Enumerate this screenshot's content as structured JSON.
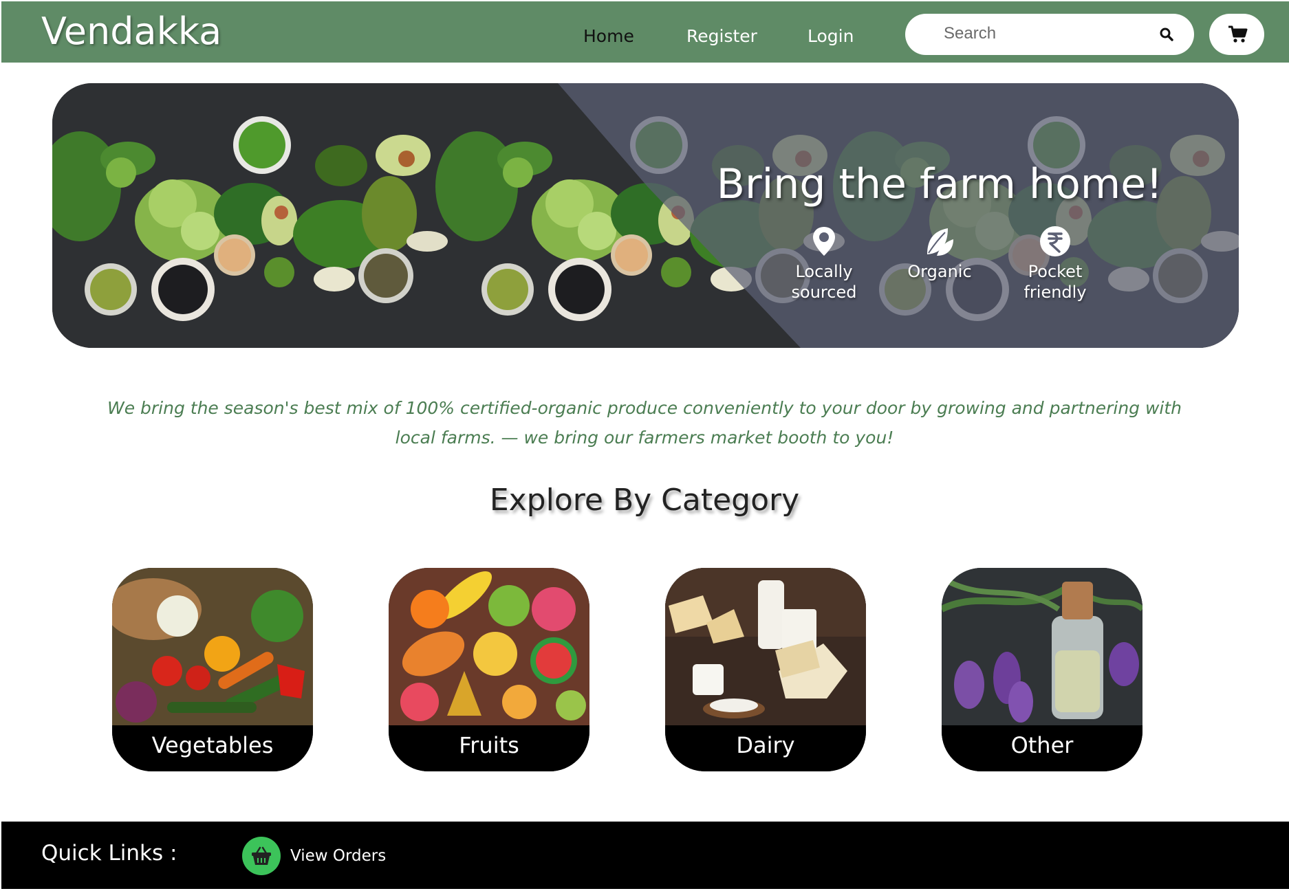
{
  "header": {
    "brand": "Vendakka",
    "nav": {
      "home": "Home",
      "register": "Register",
      "login": "Login"
    },
    "search": {
      "placeholder": "Search"
    },
    "cart_icon": "shopping-cart-icon",
    "search_icon": "magnifier-icon",
    "background_color": "#5f8b66"
  },
  "hero": {
    "title": "Bring the farm home!",
    "features": [
      {
        "icon": "map-pin-icon",
        "line1": "Locally",
        "line2": "sourced"
      },
      {
        "icon": "leaf-icon",
        "line1": "Organic",
        "line2": ""
      },
      {
        "icon": "rupee-icon",
        "line1": "Pocket",
        "line2": "friendly"
      }
    ]
  },
  "tagline": {
    "line1": "We bring the season's best mix of 100% certified-organic produce conveniently to your door by growing and partnering with",
    "line2": "local farms. — we bring our farmers market booth to you!",
    "color": "#4b7d52"
  },
  "categories": {
    "title": "Explore By Category",
    "items": [
      {
        "label": "Vegetables"
      },
      {
        "label": "Fruits"
      },
      {
        "label": "Dairy"
      },
      {
        "label": "Other"
      }
    ]
  },
  "footer": {
    "quick_links_label": "Quick Links :",
    "view_orders": {
      "label": "View Orders",
      "icon": "basket-icon",
      "icon_color": "#3cc35a"
    }
  }
}
